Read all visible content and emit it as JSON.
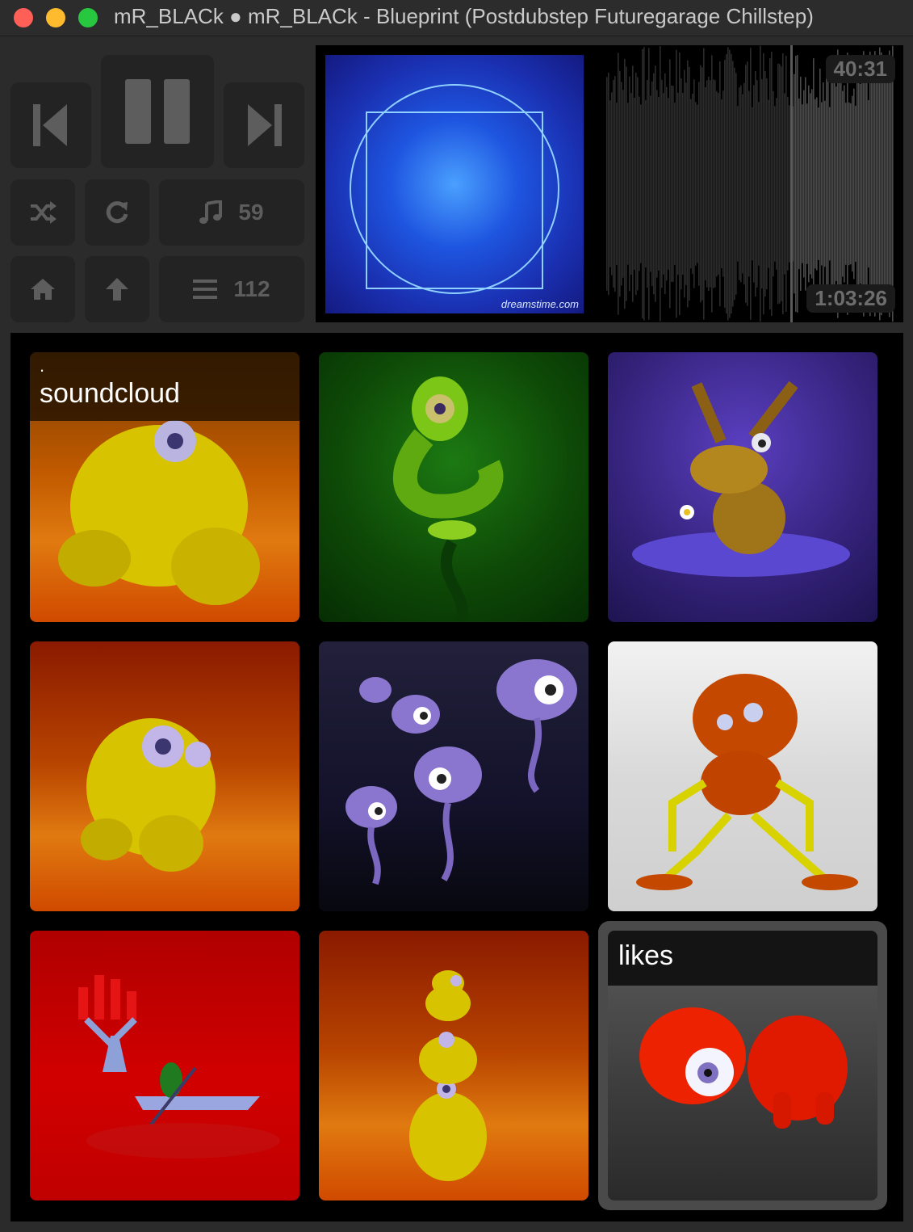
{
  "window": {
    "title": "mR_BLACk ● mR_BLACk - Blueprint (Postdubstep Futuregarage Chillstep)"
  },
  "controls": {
    "shuffle_count": "59",
    "queue_count": "112",
    "icons": [
      "previous-icon",
      "pause-icon",
      "next-icon",
      "shuffle-icon",
      "repeat-icon",
      "music-note-icon",
      "home-icon",
      "up-arrow-icon",
      "list-icon"
    ]
  },
  "player": {
    "elapsed": "40:31",
    "duration": "1:03:26",
    "progress": 0.64,
    "artwork_watermark": "dreamstime.com"
  },
  "tiles": [
    {
      "label_dot": ".",
      "label_name": "soundcloud"
    },
    {
      "label_name": ""
    },
    {
      "label_name": ""
    },
    {
      "label_name": ""
    },
    {
      "label_name": ""
    },
    {
      "label_name": ""
    },
    {
      "label_name": ""
    },
    {
      "label_name": ""
    },
    {
      "label_name": "likes"
    }
  ],
  "colors": {
    "background": "#2b2b2b",
    "button": "#232323",
    "icon": "#5d5d5d",
    "grid_background": "#000000"
  }
}
